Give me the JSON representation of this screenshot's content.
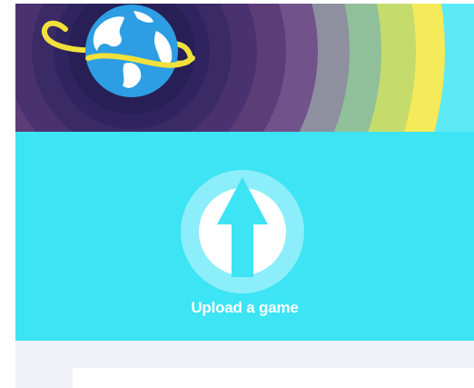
{
  "banner": {
    "logo_icon": "globe-with-orbit-icon",
    "colors": {
      "center": "#271f56",
      "rings": [
        "#2f2460",
        "#3a2a66",
        "#4a3270",
        "#5c3d78",
        "#72528a",
        "#8e8f9f",
        "#8fc09a",
        "#c5dc6c",
        "#f4ea5a"
      ],
      "edge": "#5ee9f6",
      "globe_ocean": "#2d9ee3",
      "globe_land": "#ffffff",
      "orbit": "#f2e13a"
    }
  },
  "upload": {
    "label": "Upload a game",
    "icon": "upload-arrow-icon",
    "background": "#3de4f3"
  }
}
